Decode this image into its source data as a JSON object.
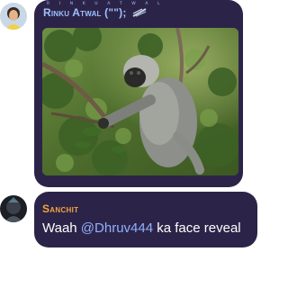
{
  "messages": [
    {
      "sender": "Rinku Atwal (\"\");",
      "sender_superscript": "R I N K U A T W A L",
      "sender_badge_icon": "sparkle-badge-icon",
      "attachment_icon": "photo-of-langur-monkey-in-tree",
      "name_color": "#9ec1ff"
    },
    {
      "sender": "Sanchit",
      "text_prefix": "Waah ",
      "mention": "@Dhruv444",
      "text_suffix": " ka face reveal",
      "name_color": "#f3a33c",
      "mention_color": "#8fb1ff"
    }
  ],
  "colors": {
    "bubble_bg": "#2c2448",
    "page_bg": "#ffffff",
    "text": "#ffffff"
  }
}
